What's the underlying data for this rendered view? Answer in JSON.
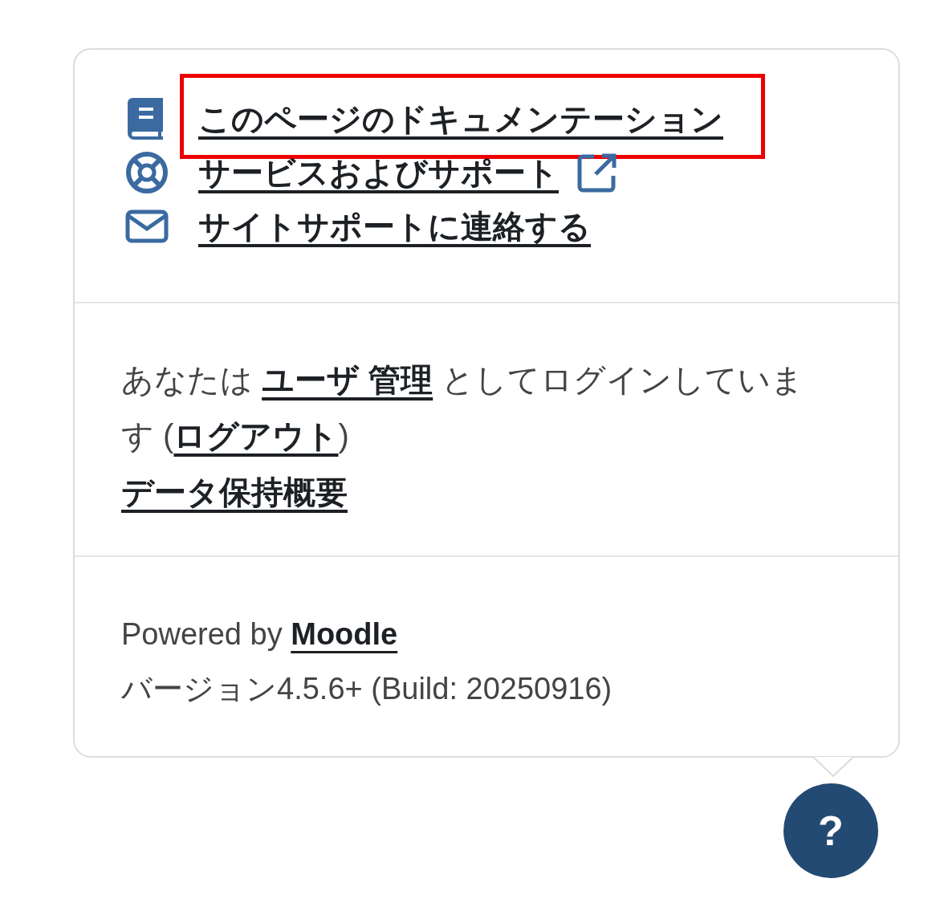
{
  "help_links": [
    {
      "kind": "documentation",
      "label": "このページのドキュメンテーション",
      "external": false,
      "highlighted": true
    },
    {
      "kind": "support",
      "label": "サービスおよびサポート",
      "external": true,
      "highlighted": false
    },
    {
      "kind": "contact",
      "label": "サイトサポートに連絡する",
      "external": false,
      "highlighted": false
    }
  ],
  "login": {
    "prefix": "あなたは",
    "user": "ユーザ 管理",
    "middle": "としてログインしています",
    "open": "(",
    "logout": "ログアウト",
    "close": ")"
  },
  "data_retention": "データ保持概要",
  "powered": {
    "prefix": "Powered by",
    "link": "Moodle"
  },
  "version": "バージョン4.5.6+ (Build: 20250916)",
  "help_button": "?"
}
